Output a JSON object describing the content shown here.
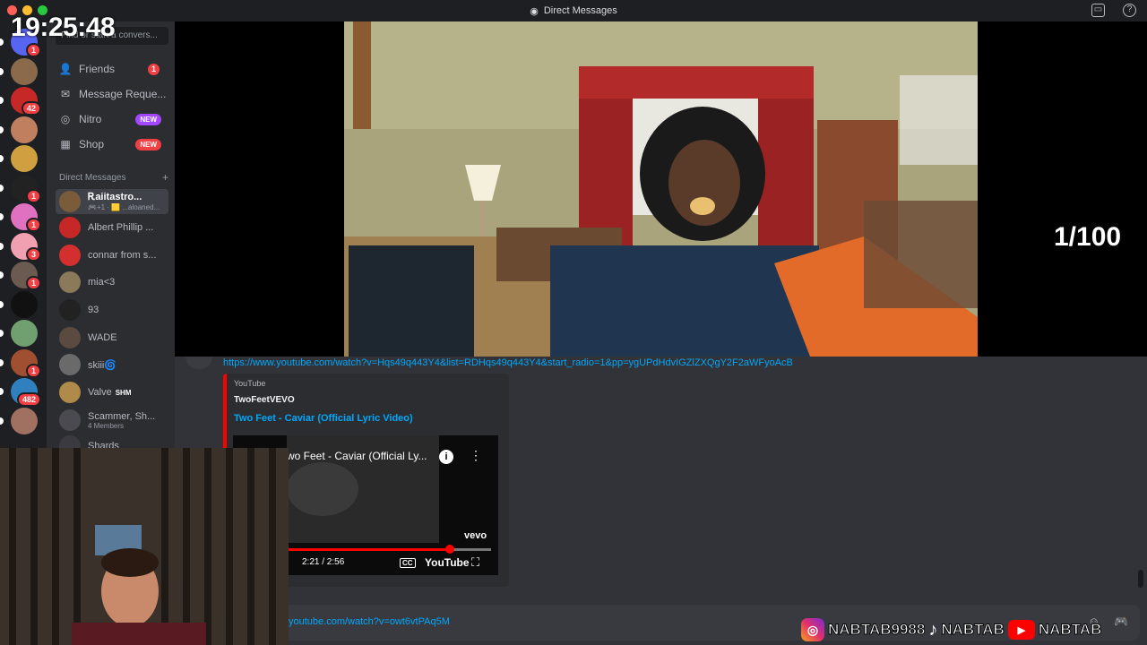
{
  "window": {
    "title": "Direct Messages"
  },
  "overlay": {
    "clock": "19:25:48",
    "counter": "1/100"
  },
  "search": {
    "placeholder": "Find or start a convers..."
  },
  "nav": [
    {
      "label": "Friends",
      "icon": "friends-icon",
      "badge": "1"
    },
    {
      "label": "Message Reque...",
      "icon": "envelope-icon"
    },
    {
      "label": "Nitro",
      "icon": "nitro-icon",
      "tag": "NEW"
    },
    {
      "label": "Shop",
      "icon": "shop-icon",
      "tag": "NEW"
    }
  ],
  "dm_section": {
    "title": "Direct Messages",
    "add": "+"
  },
  "dms": [
    {
      "name": "Ꭱaiitastro...",
      "sub": "🎮+1 · 🟨 ...aloaned...",
      "color": "#7a5b3a",
      "active": true
    },
    {
      "name": "Albert Phillip ...",
      "color": "#c62828"
    },
    {
      "name": "connar from s...",
      "color": "#d32f2f"
    },
    {
      "name": "mia<3",
      "color": "#8a7a5a"
    },
    {
      "name": "93",
      "color": "#222222"
    },
    {
      "name": "WADE",
      "color": "#5a4a40"
    },
    {
      "name": "skiii🌀",
      "color": "#6a6a6a"
    },
    {
      "name": "Valve",
      "tag": "SHM",
      "color": "#b08a4a"
    },
    {
      "name": "Scammer, Sh...",
      "sub": "4 Members",
      "color": "#4a4a50"
    },
    {
      "name": "Shards",
      "color": "#3a3a40"
    }
  ],
  "servers": [
    {
      "color": "#5865f2",
      "badge": "1"
    },
    {
      "color": "#8a6a4a",
      "badge": ""
    },
    {
      "color": "#c62828",
      "badge": "42"
    },
    {
      "color": "#c08060",
      "badge": ""
    },
    {
      "color": "#d0a040",
      "badge": ""
    },
    {
      "color": "#222222",
      "badge": "1"
    },
    {
      "color": "#e070c0",
      "badge": "1"
    },
    {
      "color": "#f0a0b0",
      "badge": "3"
    },
    {
      "color": "#6a5a50",
      "badge": "1"
    },
    {
      "color": "#111111",
      "badge": ""
    },
    {
      "color": "#70a070",
      "badge": ""
    },
    {
      "color": "#a05030",
      "badge": "1"
    },
    {
      "color": "#3080c0",
      "badge": "482"
    },
    {
      "color": "#a07060",
      "badge": ""
    }
  ],
  "message": {
    "link": "https://www.youtube.com/watch?v=Hqs49q443Y4&list=RDHqs49q443Y4&start_radio=1&pp=ygUPdHdvIGZlZXQgY2F2aWFyoAcB",
    "embed": {
      "provider": "YouTube",
      "author": "TwoFeetVEVO",
      "title": "Two Feet - Caviar (Official Lyric Video)",
      "player_title": "wo Feet - Caviar (Official Ly...",
      "time": "2:21 / 2:56",
      "progress": 0.8,
      "vevo": "vevo",
      "yt_logo": "YouTube",
      "cc": "CC"
    }
  },
  "second_link": "youtube.com/watch?v=owt6vtPAq5M",
  "social": {
    "instagram": "NABTAB9988",
    "tiktok": "NABTAB",
    "youtube": "NABTAB"
  }
}
